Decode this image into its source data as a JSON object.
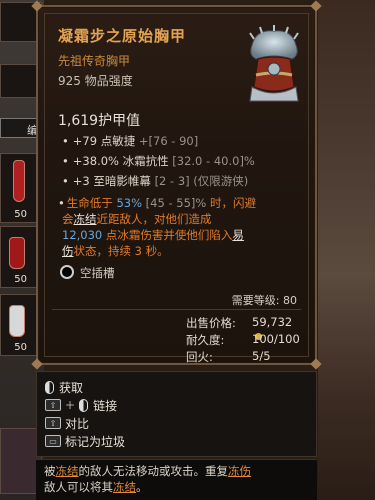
{
  "item": {
    "name": "凝霜步之原始胸甲",
    "type": "先祖传奇胸甲",
    "power": "925 物品强度",
    "armor": "1,619护甲值"
  },
  "affixes": [
    {
      "text": "+79 点敏捷 ",
      "range": "+[76 - 90]"
    },
    {
      "text": "+38.0% 冰霜抗性 ",
      "range": "[32.0 - 40.0]%"
    },
    {
      "text": "+3 至暗影帷幕 ",
      "range": "[2 - 3] (仅限游侠)"
    }
  ],
  "unique": {
    "p1": "生命低于 ",
    "pct": "53%",
    "range": " [45 - 55]%",
    "p2": " 时，闪避",
    "p3": "会",
    "freeze": "冻结",
    "p4": "近距敌人，对他们造成",
    "dmg": "12,030",
    "p5": " 点冰霜伤害并使他们陷入",
    "vuln_a": "易",
    "vuln_b": "伤",
    "p6": "状态，持续 3 秒。"
  },
  "socket_label": "空插槽",
  "required_level": "需要等级: 80",
  "stats": {
    "sell_label": "出售价格:",
    "sell_value": "59,732",
    "durability_label": "耐久度:",
    "durability_value": "100/100",
    "fire_label": "回火:",
    "fire_value": "5/5"
  },
  "actions": {
    "take": "获取",
    "link": "链接",
    "compare": "对比",
    "junk": "标记为垃圾"
  },
  "hint": {
    "a": "被",
    "freeze": "冻结",
    "b": "的敌人无法移动或攻击。重复",
    "frost": "冻伤",
    "c": "敌人可以将其",
    "freeze2": "冻结",
    "d": "。"
  },
  "inventory": {
    "qty1": "50",
    "qty2": "50",
    "qty3": "50",
    "tab": "编"
  },
  "colors": {
    "legendary": "#e3a354",
    "unique_text": "#e07a2a",
    "highlight": "#6aa4d8"
  }
}
